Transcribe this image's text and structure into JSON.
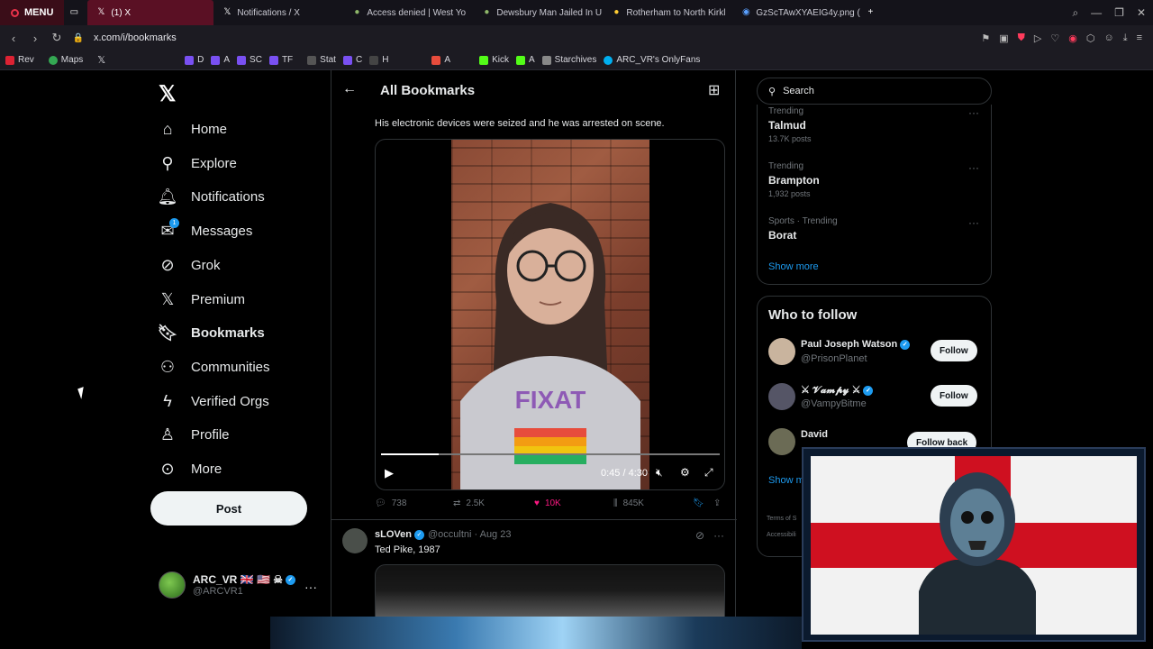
{
  "browser": {
    "menu_label": "MENU",
    "tabs": [
      {
        "title": "(1) X",
        "icon": "x-icon",
        "active": true
      },
      {
        "title": "Notifications / X",
        "icon": "x-icon"
      },
      {
        "title": "Access denied | West Yo",
        "icon": "police-icon"
      },
      {
        "title": "Dewsbury Man Jailed In U",
        "icon": "police-icon"
      },
      {
        "title": "Rotherham to North Kirkl",
        "icon": "map-pin-icon"
      },
      {
        "title": "GzScTAwXYAEIG4y.png (",
        "icon": "globe-icon"
      }
    ],
    "url": "x.com/i/bookmarks",
    "bookmarks": [
      "Rev",
      "Maps",
      "D",
      "A",
      "SC",
      "TF",
      "Stat",
      "C",
      "H",
      "A",
      "Kick",
      "A",
      "Starchives",
      "ARC_VR's OnlyFans"
    ]
  },
  "nav": {
    "items": [
      {
        "label": "Home",
        "icon": "home-icon"
      },
      {
        "label": "Explore",
        "icon": "search-icon"
      },
      {
        "label": "Notifications",
        "icon": "bell-icon"
      },
      {
        "label": "Messages",
        "icon": "mail-icon",
        "badge": "1"
      },
      {
        "label": "Grok",
        "icon": "grok-icon"
      },
      {
        "label": "Premium",
        "icon": "x-icon"
      },
      {
        "label": "Bookmarks",
        "icon": "bookmark-icon"
      },
      {
        "label": "Communities",
        "icon": "communities-icon"
      },
      {
        "label": "Verified Orgs",
        "icon": "lightning-icon"
      },
      {
        "label": "Profile",
        "icon": "person-icon"
      },
      {
        "label": "More",
        "icon": "more-circle-icon"
      }
    ],
    "post_label": "Post",
    "account": {
      "name": "ARC_VR 🇬🇧 🇺🇸 ☠",
      "handle": "@ARCVR1"
    }
  },
  "feed": {
    "title": "All Bookmarks",
    "tweet1": {
      "text": "His electronic devices were seized and he was arrested on scene.",
      "video_time": "0:45 / 4:30",
      "progress": 0.17,
      "replies": "738",
      "reposts": "2.5K",
      "likes": "10K",
      "views": "845K"
    },
    "tweet2": {
      "name": "sLOVen",
      "handle": "@occultni · Aug 23",
      "text": "Ted Pike, 1987"
    }
  },
  "sidebar": {
    "search_placeholder": "Search",
    "trends": [
      {
        "category": "Trending",
        "name": "Talmud",
        "count": "13.7K posts"
      },
      {
        "category": "Trending",
        "name": "Brampton",
        "count": "1,932 posts"
      },
      {
        "category": "Sports · Trending",
        "name": "Borat",
        "count": ""
      }
    ],
    "show_more": "Show more",
    "who_to_follow_title": "Who to follow",
    "who_to_follow": [
      {
        "name": "Paul Joseph Watson",
        "handle": "@PrisonPlanet",
        "button": "Follow"
      },
      {
        "name": "⚔ 𝓥𝓪𝓶𝓹𝔂 ⚔",
        "handle": "@VampyBitme",
        "button": "Follow"
      },
      {
        "name": "David",
        "handle": "",
        "button": "Follow back"
      }
    ],
    "wtf_show_more": "Show m",
    "footer1": "Terms of S",
    "footer2": "Accessibili"
  },
  "colors": {
    "accent": "#1d9bf0",
    "like": "#f91880",
    "flag_red": "#cf1020"
  }
}
